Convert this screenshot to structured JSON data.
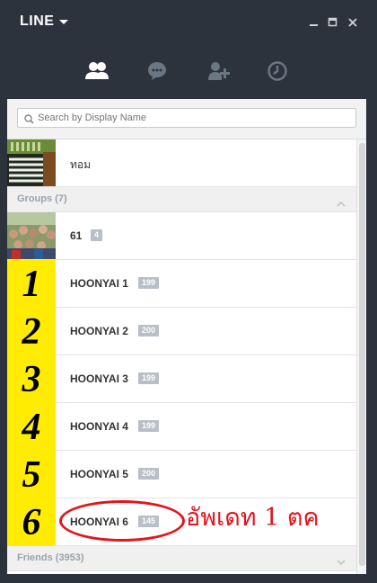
{
  "app": {
    "title": "LINE"
  },
  "search": {
    "placeholder": "Search by Display Name"
  },
  "top_contact": {
    "name": "ทอม"
  },
  "groups_header": "Groups (7)",
  "groups": [
    {
      "name": "61",
      "count": "4",
      "avatar": "photo"
    },
    {
      "name": "HOONYAI 1",
      "count": "199",
      "avatar_number": "1"
    },
    {
      "name": "HOONYAI 2",
      "count": "200",
      "avatar_number": "2"
    },
    {
      "name": "HOONYAI 3",
      "count": "199",
      "avatar_number": "3"
    },
    {
      "name": "HOONYAI 4",
      "count": "199",
      "avatar_number": "4"
    },
    {
      "name": "HOONYAI 5",
      "count": "200",
      "avatar_number": "5"
    },
    {
      "name": "HOONYAI 6",
      "count": "145",
      "avatar_number": "6"
    }
  ],
  "friends_header": "Friends (3953)",
  "annotation": "อัพเดท 1 ตค",
  "colors": {
    "frame": "#2c333d",
    "avatar_yellow": "#ffec00",
    "annotation_red": "#e4141b",
    "badge": "#b8bfc7"
  }
}
